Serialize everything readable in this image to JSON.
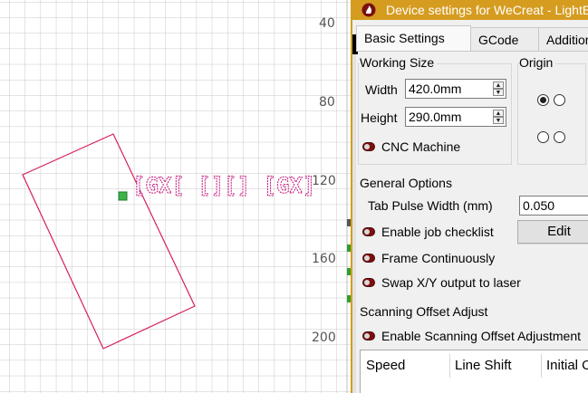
{
  "ruler": {
    "labels": [
      "40",
      "80",
      "120",
      "160",
      "200"
    ]
  },
  "design": {
    "text": "[GX[ [][] [GX]",
    "stroke_color": "#c4107a",
    "handle_color": "#3cb44b"
  },
  "dialog": {
    "title": "Device settings for WeCreat - LightBurn",
    "title_color": "#d59c20",
    "tabs": [
      {
        "label": "Basic Settings",
        "active": true
      },
      {
        "label": "GCode",
        "active": false
      },
      {
        "label": "Additional Settings",
        "active": false
      }
    ],
    "working_size": {
      "label": "Working Size",
      "width_label": "Width",
      "width_value": "420.0mm",
      "height_label": "Height",
      "height_value": "290.0mm",
      "cnc_label": "CNC Machine"
    },
    "origin": {
      "label": "Origin",
      "selected": "top-left"
    },
    "general": {
      "label": "General Options",
      "tab_pulse_label": "Tab Pulse Width (mm)",
      "tab_pulse_value": "0.050",
      "job_checklist_label": "Enable job checklist",
      "edit_label": "Edit",
      "frame_label": "Frame Continuously",
      "swap_label": "Swap X/Y output to laser"
    },
    "scanning": {
      "label": "Scanning Offset Adjust",
      "enable_label": "Enable Scanning Offset Adjustment",
      "columns": [
        "Speed",
        "Line Shift",
        "Initial Offset"
      ]
    }
  }
}
